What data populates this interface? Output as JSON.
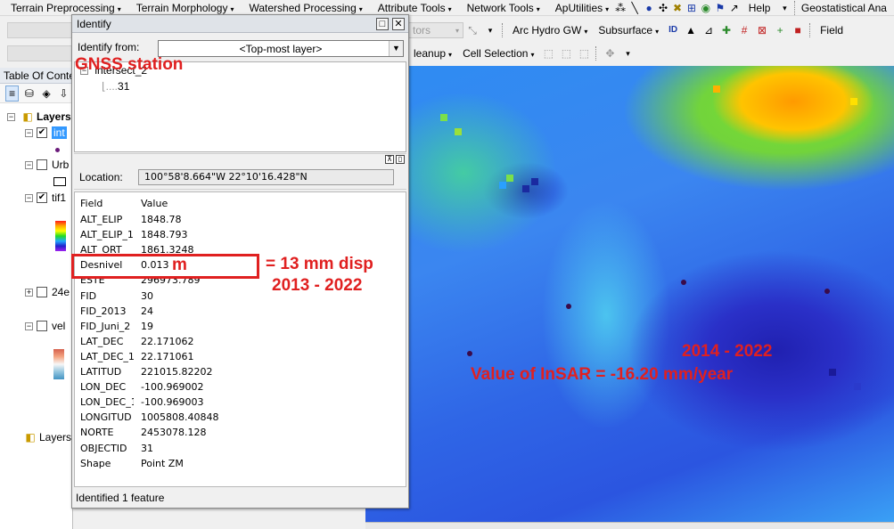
{
  "menubar": {
    "items": [
      "Terrain Preprocessing",
      "Terrain Morphology",
      "Watershed Processing",
      "Attribute Tools",
      "Network Tools",
      "ApUtilities"
    ],
    "help": "Help",
    "right_title": "Geostatistical Ana"
  },
  "toolbar2": {
    "ghost_dropdown": "tors",
    "arc_hydro_gw": "Arc Hydro GW",
    "subsurface": "Subsurface",
    "field": "Field"
  },
  "toolbar3": {
    "cleanup": "leanup",
    "cell_selection": "Cell Selection"
  },
  "toc": {
    "title": "Table Of Conte",
    "layers_root": "Layers",
    "items": [
      {
        "label": "int",
        "checked": true
      },
      {
        "label": "Urb",
        "checked": false
      },
      {
        "label": "tif1",
        "checked": true
      },
      {
        "label": "24e",
        "checked": false
      },
      {
        "label": "vel",
        "checked": false
      }
    ],
    "layers_bottom": "Layers"
  },
  "identify": {
    "title": "Identify",
    "from_label": "Identify from:",
    "from_value": "<Top-most layer>",
    "tree_parent": "intersect_2",
    "tree_child": "31",
    "location_label": "Location:",
    "location_value": "100°58'8.664\"W  22°10'16.428\"N",
    "col_field": "Field",
    "col_value": "Value",
    "rows": [
      {
        "field": "ALT_ELIP",
        "value": "1848.78"
      },
      {
        "field": "ALT_ELIP_1",
        "value": "1848.793"
      },
      {
        "field": "ALT_ORT",
        "value": "1861.3248"
      },
      {
        "field": "Desnivel",
        "value": "0.013"
      },
      {
        "field": "ESTE",
        "value": "296973.789"
      },
      {
        "field": "FID",
        "value": "30"
      },
      {
        "field": "FID_2013",
        "value": "24"
      },
      {
        "field": "FID_Juni_2",
        "value": "19"
      },
      {
        "field": "LAT_DEC",
        "value": "22.171062"
      },
      {
        "field": "LAT_DEC_1",
        "value": "22.171061"
      },
      {
        "field": "LATITUD",
        "value": "221015.82202"
      },
      {
        "field": "LON_DEC",
        "value": "-100.969002"
      },
      {
        "field": "LON_DEC_1",
        "value": "-100.969003"
      },
      {
        "field": "LONGITUD",
        "value": "1005808.40848"
      },
      {
        "field": "NORTE",
        "value": "2453078.128"
      },
      {
        "field": "OBJECTID",
        "value": "31"
      },
      {
        "field": "Shape",
        "value": "Point ZM"
      }
    ],
    "status": "Identified 1 feature"
  },
  "annotations": {
    "gnss": "GNSS station",
    "unit_m": "m",
    "disp_line1": "= 13 mm disp",
    "disp_line2": "2013 - 2022",
    "insar_period": "2014 - 2022",
    "insar_value": "Value of InSAR = -16.20 mm/year",
    "color": "#e02020"
  }
}
